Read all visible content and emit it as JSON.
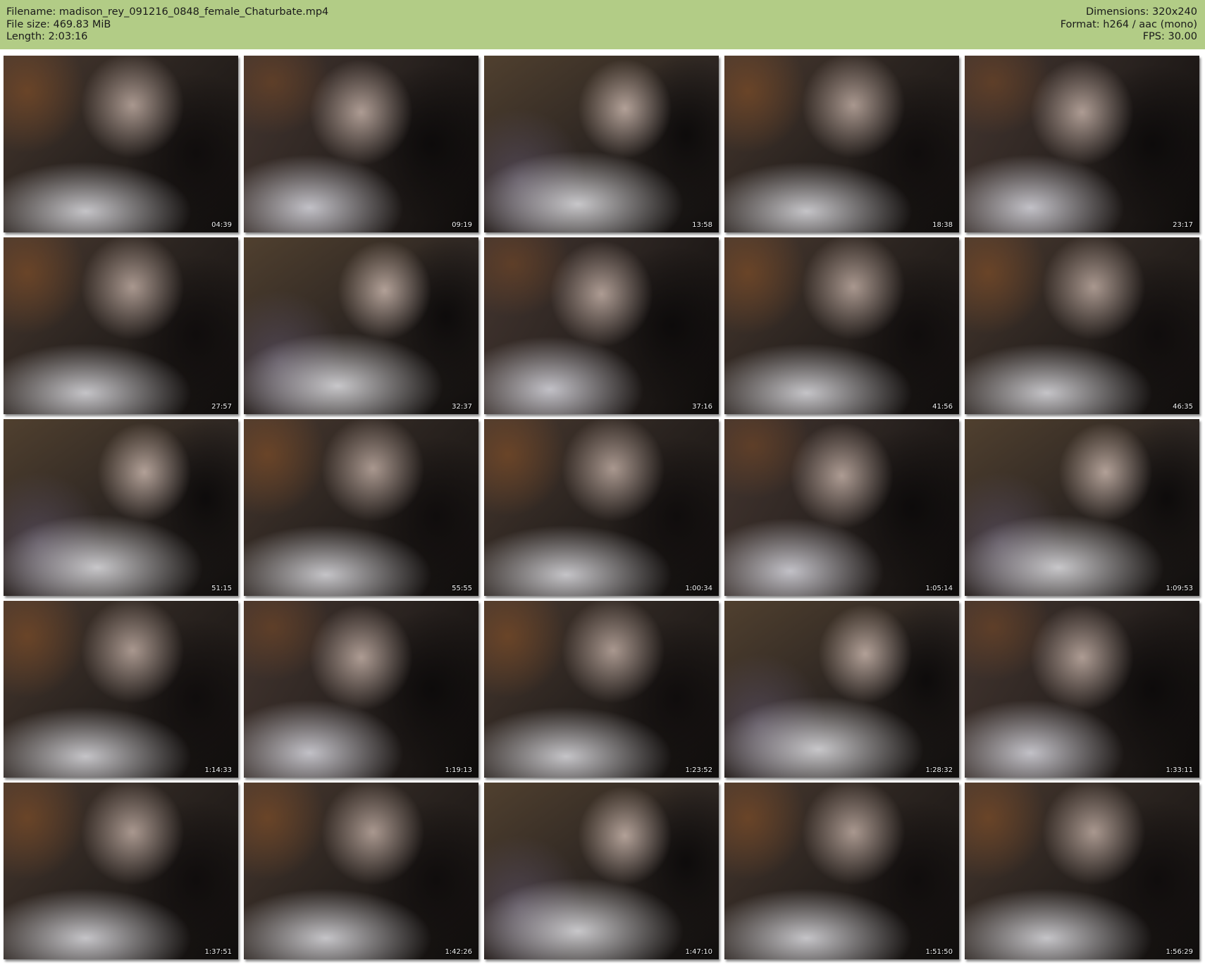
{
  "header": {
    "filename": "Filename: madison_rey_091216_0848_female_Chaturbate.mp4",
    "filesize": "File size: 469.83 MiB",
    "length": "Length: 2:03:16",
    "dimensions": "Dimensions: 320x240",
    "format": "Format: h264 / aac (mono)",
    "fps": "FPS: 30.00",
    "background_color": "#b2cc86"
  },
  "thumbnails": [
    {
      "timestamp": "04:39"
    },
    {
      "timestamp": "09:19"
    },
    {
      "timestamp": "13:58"
    },
    {
      "timestamp": "18:38"
    },
    {
      "timestamp": "23:17"
    },
    {
      "timestamp": "27:57"
    },
    {
      "timestamp": "32:37"
    },
    {
      "timestamp": "37:16"
    },
    {
      "timestamp": "41:56"
    },
    {
      "timestamp": "46:35"
    },
    {
      "timestamp": "51:15"
    },
    {
      "timestamp": "55:55"
    },
    {
      "timestamp": "1:00:34"
    },
    {
      "timestamp": "1:05:14"
    },
    {
      "timestamp": "1:09:53"
    },
    {
      "timestamp": "1:14:33"
    },
    {
      "timestamp": "1:19:13"
    },
    {
      "timestamp": "1:23:52"
    },
    {
      "timestamp": "1:28:32"
    },
    {
      "timestamp": "1:33:11"
    },
    {
      "timestamp": "1:37:51"
    },
    {
      "timestamp": "1:42:26"
    },
    {
      "timestamp": "1:47:10"
    },
    {
      "timestamp": "1:51:50"
    },
    {
      "timestamp": "1:56:29"
    }
  ]
}
